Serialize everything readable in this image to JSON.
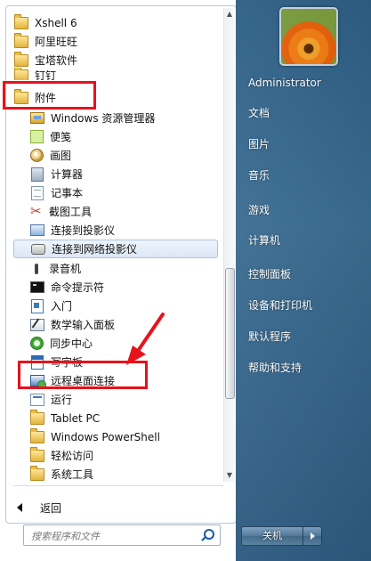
{
  "program_list": {
    "top_items": [
      {
        "label": "Xshell 6",
        "icon": "folder-icon"
      },
      {
        "label": "阿里旺旺",
        "icon": "folder-icon"
      },
      {
        "label": "宝塔软件",
        "icon": "folder-icon"
      },
      {
        "label": "钉钉",
        "icon": "folder-icon"
      },
      {
        "label": "附件",
        "icon": "folder-icon"
      }
    ],
    "accessory_items": [
      {
        "label": "Windows 资源管理器",
        "icon": "explorer-icon"
      },
      {
        "label": "便笺",
        "icon": "sticky-notes-icon"
      },
      {
        "label": "画图",
        "icon": "paint-icon"
      },
      {
        "label": "计算器",
        "icon": "calculator-icon"
      },
      {
        "label": "记事本",
        "icon": "notepad-icon"
      },
      {
        "label": "截图工具",
        "icon": "snipping-tool-icon"
      },
      {
        "label": "连接到投影仪",
        "icon": "projector-icon"
      },
      {
        "label": "连接到网络投影仪",
        "icon": "network-projector-icon"
      },
      {
        "label": "录音机",
        "icon": "microphone-icon"
      },
      {
        "label": "命令提示符",
        "icon": "command-prompt-icon"
      },
      {
        "label": "入门",
        "icon": "getting-started-icon"
      },
      {
        "label": "数学输入面板",
        "icon": "math-input-icon"
      },
      {
        "label": "同步中心",
        "icon": "sync-center-icon"
      },
      {
        "label": "写字板",
        "icon": "wordpad-icon"
      },
      {
        "label": "远程桌面连接",
        "icon": "remote-desktop-icon"
      },
      {
        "label": "运行",
        "icon": "run-icon"
      },
      {
        "label": "Tablet PC",
        "icon": "folder-icon"
      },
      {
        "label": "Windows PowerShell",
        "icon": "folder-icon"
      },
      {
        "label": "轻松访问",
        "icon": "folder-icon"
      },
      {
        "label": "系统工具",
        "icon": "folder-icon"
      }
    ],
    "selected_item": "连接到网络投影仪"
  },
  "back_label": "返回",
  "search": {
    "placeholder": "搜索程序和文件"
  },
  "right_pane": {
    "user_name": "Administrator",
    "items": [
      "文档",
      "图片",
      "音乐",
      "游戏",
      "计算机",
      "控制面板",
      "设备和打印机",
      "默认程序",
      "帮助和支持"
    ]
  },
  "shutdown_label": "关机",
  "colors": {
    "annotation": "#e8121b",
    "right_pane": "#2e5f85",
    "selection": "#dce8f5"
  }
}
